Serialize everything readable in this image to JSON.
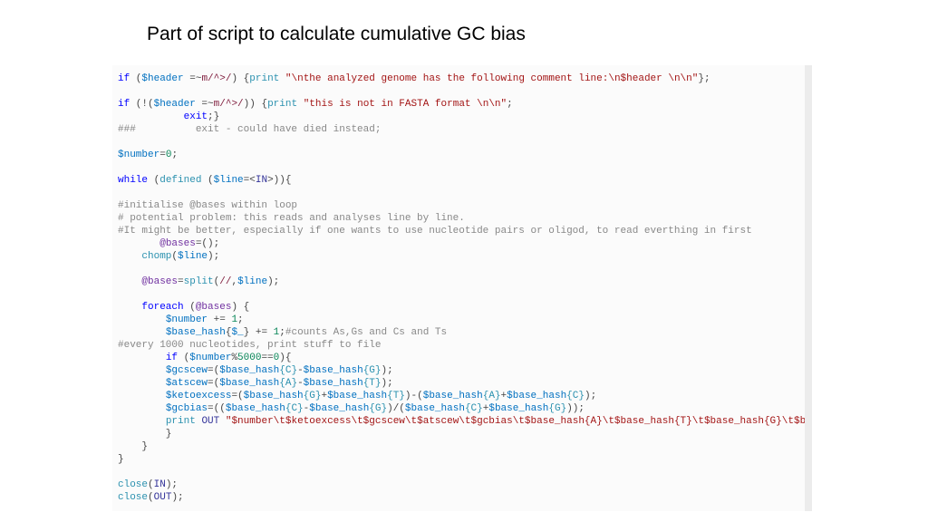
{
  "title": "Part of script to calculate cumulative GC bias",
  "code": {
    "frag": {
      "kw_if": "if",
      "kw_while": "while",
      "kw_foreach": "foreach",
      "kw_exit": "exit",
      "fn_print": "print",
      "fn_chomp": "chomp",
      "fn_split": "split",
      "fn_close": "close",
      "fn_defined": "defined",
      "v_header": "$header",
      "v_line": "$line",
      "v_number": "$number",
      "v_gcscew": "$gcscew",
      "v_atscew": "$atscew",
      "v_ketoexcess": "$ketoexcess",
      "v_gcbias": "$gcbias",
      "v_underscore": "$_",
      "v_basehash": "$base_hash",
      "a_bases": "@bases",
      "rx1": "m/^>/",
      "rx2": "m/^>/",
      "rx3": "//",
      "str1": "\"\\nthe analyzed genome has the following comment line:\\n$header \\n\\n\"",
      "str2": "\"this is not in FASTA format \\n\\n\"",
      "str3": "\"$number\\t$ketoexcess\\t$gcscew\\t$atscew\\t$gcbias\\t$base_hash{A}\\t$base_hash{T}\\t$base_hash{G}\\t$base_hash{C}\\n\"",
      "n0": "0",
      "n1": "1",
      "n5000": "5000",
      "cmt1": "###          exit - could have died instead;",
      "cmt2": "#initialise @bases within loop",
      "cmt3": "# potential problem: this reads and analyses line by line.",
      "cmt4": "#It might be better, especially if one wants to use nucleotide pairs or oligod, to read everthing in first",
      "cmt5": "#counts As,Gs and Cs and Ts",
      "cmt6": "#every 1000 nucleotides, print stuff to file",
      "key_G": "{G}",
      "key_C": "{C}",
      "key_A": "{A}",
      "key_T": "{T}",
      "out_IN": "IN",
      "out_OUT": "OUT"
    }
  }
}
